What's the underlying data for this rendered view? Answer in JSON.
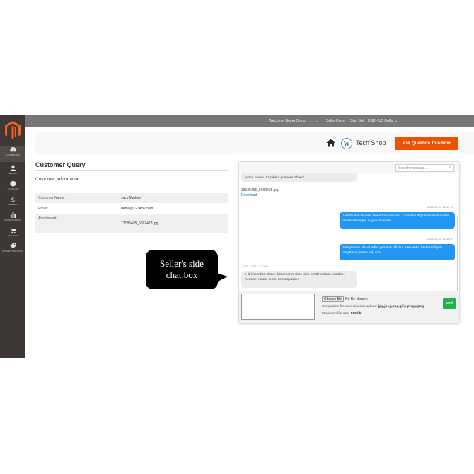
{
  "sidebar": {
    "items": [
      {
        "label": "Dashboard",
        "icon": "dashboard-icon"
      },
      {
        "label": "Seller",
        "icon": "user-icon"
      },
      {
        "label": "Catalog",
        "icon": "cube-icon"
      },
      {
        "label": "Orders",
        "icon": "dollar-icon"
      },
      {
        "label": "Transactions",
        "icon": "bar-chart-icon"
      },
      {
        "label": "Payouts",
        "icon": "cart-icon"
      },
      {
        "label": "Payment Method",
        "icon": "tag-icon"
      }
    ]
  },
  "topbar": {
    "welcome": "Welcome, Demo Demo!",
    "seller_panel": "Seller Panel",
    "sign_out": "Sign Out",
    "currency": "USD - US Dollar"
  },
  "header": {
    "brand_letter": "W",
    "brand_name": "Tech Shop",
    "ask_button": "Ask Question To Admin"
  },
  "main": {
    "title": "Customer Query",
    "section": "Customer Information",
    "rows": [
      {
        "label": "Customer Name:",
        "value": "Jack Marlow"
      },
      {
        "label": "Email:",
        "value": "demo@123456.com"
      },
      {
        "label": "Attachment:",
        "value": "13185405_5092428.jpg"
      }
    ]
  },
  "chat": {
    "search_placeholder": "Search message...",
    "messages": {
      "m1_text": "lectus metus. Curabitur posuere bibend",
      "m1_file": "13185405_5092428.jpg",
      "m1_download": "Download",
      "m2_time": "2023-12-15 10:10:18",
      "m2_text": "Vestibulum facilisis bibendum aliquam. Curabitur dignissim eros massa, sed scelerisque augue molestie",
      "m3_time": "2023-12-15 10:10:23",
      "m3_text": "Integer non nisl et tellus pulvinar efficitur a eu ante. Sed erat ligula, sagittis ac purus vel, oda",
      "m4_time": "2023-12-15 10:10:46",
      "m4_text": "s id imperdiet. Etiam dictum eros vitae nibh condimentum sodales. Aenean mauris nunc, consequat in t"
    },
    "choose_file": "Choose file",
    "no_file": "No file chosen",
    "compat_label": "Compatible file extensions to upload:",
    "compat_value": "jpg,jpeg,png,gif,x-png,pjpeg",
    "max_label": "Maximum file size:",
    "max_value": "500 kb",
    "send": "send"
  },
  "callout": {
    "line1": "Seller's side",
    "line2": "chat box"
  },
  "colors": {
    "sidebar": "#3d3836",
    "accent": "#eb5202",
    "chat_out": "#2196f3",
    "send": "#22b14c"
  }
}
